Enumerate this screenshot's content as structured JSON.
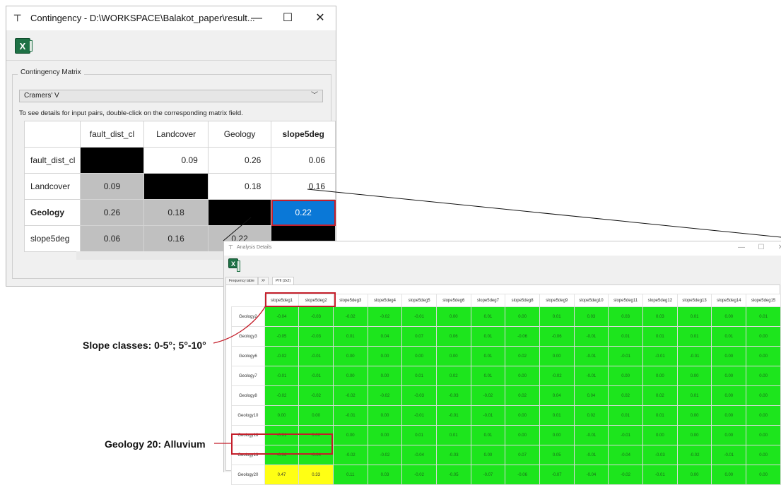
{
  "contingency_window": {
    "title": "Contingency - D:\\WORKSPACE\\Balakot_paper\\result...",
    "minimize": "—",
    "maximize": "☐",
    "close": "✕",
    "excel_button": "X",
    "group_label": "Contingency Matrix",
    "measure_select": "Cramers' V",
    "hint": "To see details for input pairs, double-click on the corresponding matrix field.",
    "matrix": {
      "columns": [
        "fault_dist_cl",
        "Landcover",
        "Geology",
        "slope5deg"
      ],
      "rows": [
        {
          "label": "fault_dist_cl",
          "cells": [
            "",
            "0.09",
            "0.26",
            "0.06"
          ]
        },
        {
          "label": "Landcover",
          "cells": [
            "0.09",
            "",
            "0.18",
            "0.16"
          ]
        },
        {
          "label": "Geology",
          "cells": [
            "0.26",
            "0.18",
            "",
            "0.22"
          ]
        },
        {
          "label": "slope5deg",
          "cells": [
            "0.06",
            "0.16",
            "0.22",
            ""
          ]
        }
      ]
    }
  },
  "details_window": {
    "title": "Analysis Details",
    "minimize": "—",
    "maximize": "☐",
    "close": "✕",
    "excel_button": "X",
    "tabs": [
      "Frequency table",
      "X²",
      "PHI (2x2)"
    ],
    "phi_table": {
      "columns": [
        "slope5deg1",
        "slope5deg2",
        "slope5deg3",
        "slope5deg4",
        "slope5deg5",
        "slope5deg6",
        "slope5deg7",
        "slope5deg8",
        "slope5deg9",
        "slope5deg10",
        "slope5deg11",
        "slope5deg12",
        "slope5deg13",
        "slope5deg14",
        "slope5deg15"
      ],
      "rows": [
        {
          "label": "Geology2",
          "cells": [
            "-0.04",
            "-0.03",
            "-0.02",
            "-0.02",
            "-0.01",
            "0.00",
            "0.01",
            "0.00",
            "0.01",
            "0.03",
            "0.03",
            "0.03",
            "0.01",
            "0.00",
            "0.01"
          ]
        },
        {
          "label": "Geology3",
          "cells": [
            "-0.05",
            "-0.03",
            "0.01",
            "0.04",
            "0.07",
            "0.06",
            "0.01",
            "-0.06",
            "-0.06",
            "-0.01",
            "0.01",
            "0.01",
            "0.01",
            "0.01",
            "0.00"
          ]
        },
        {
          "label": "Geology6",
          "cells": [
            "-0.02",
            "-0.01",
            "0.00",
            "0.00",
            "0.00",
            "0.00",
            "0.01",
            "0.02",
            "0.00",
            "-0.01",
            "-0.01",
            "-0.01",
            "-0.01",
            "0.00",
            "0.00"
          ]
        },
        {
          "label": "Geology7",
          "cells": [
            "-0.01",
            "-0.01",
            "0.00",
            "0.00",
            "0.01",
            "0.02",
            "0.01",
            "0.00",
            "-0.02",
            "-0.01",
            "0.00",
            "0.00",
            "0.00",
            "0.00",
            "0.00"
          ]
        },
        {
          "label": "Geology8",
          "cells": [
            "-0.02",
            "-0.02",
            "-0.02",
            "-0.02",
            "-0.03",
            "-0.03",
            "-0.02",
            "0.02",
            "0.04",
            "0.04",
            "0.02",
            "0.02",
            "0.01",
            "0.00",
            "0.00"
          ]
        },
        {
          "label": "Geology10",
          "cells": [
            "0.00",
            "0.00",
            "-0.01",
            "0.00",
            "-0.01",
            "-0.01",
            "-0.01",
            "0.00",
            "0.01",
            "0.02",
            "0.01",
            "0.01",
            "0.00",
            "0.00",
            "0.00"
          ]
        },
        {
          "label": "Geology18",
          "cells": [
            "-0.01",
            "0.00",
            "0.00",
            "0.00",
            "0.01",
            "0.01",
            "0.01",
            "0.00",
            "0.00",
            "-0.01",
            "-0.01",
            "0.00",
            "0.00",
            "0.00",
            "0.00"
          ]
        },
        {
          "label": "Geology19",
          "cells": [
            "-0.06",
            "-0.04",
            "-0.02",
            "-0.02",
            "-0.04",
            "-0.03",
            "0.00",
            "0.07",
            "0.05",
            "-0.01",
            "-0.04",
            "-0.03",
            "-0.02",
            "-0.01",
            "0.00"
          ]
        },
        {
          "label": "Geology20",
          "cells": [
            "0.47",
            "0.33",
            "0.11",
            "0.03",
            "-0.02",
            "-0.05",
            "-0.07",
            "-0.06",
            "-0.07",
            "-0.04",
            "-0.02",
            "-0.01",
            "0.00",
            "0.00",
            "0.00"
          ]
        }
      ]
    }
  },
  "annotations": {
    "slope": "Slope classes: 0-5°; 5°-10°",
    "geology": "Geology 20: Alluvium"
  },
  "colors": {
    "selected_cell": "#0a78d7",
    "highlight_border": "#c41e2a",
    "phi_cell": "#1de51d",
    "phi_highlight": "#ffff14"
  }
}
